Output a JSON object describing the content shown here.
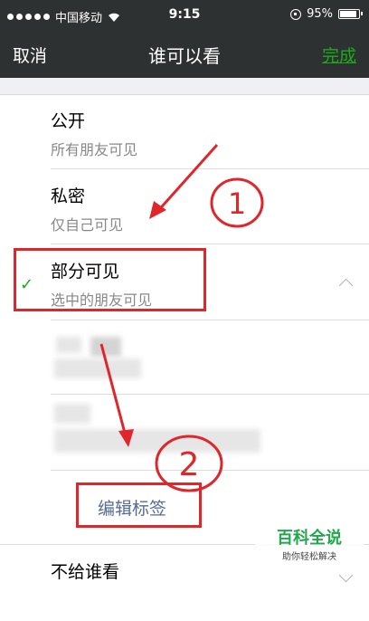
{
  "status_bar": {
    "carrier": "中国移动",
    "time": "9:15",
    "battery": "95%"
  },
  "nav": {
    "cancel": "取消",
    "title": "谁可以看",
    "done": "完成"
  },
  "options": [
    {
      "title": "公开",
      "subtitle": "所有朋友可见"
    },
    {
      "title": "私密",
      "subtitle": "仅自己可见"
    },
    {
      "title": "部分可见",
      "subtitle": "选中的朋友可见",
      "selected": true
    },
    {
      "title": "不给谁看",
      "subtitle": ""
    }
  ],
  "edit_tag": "编辑标签",
  "annotations": {
    "first": "1",
    "second": "2"
  },
  "watermark": {
    "main": "百科全说",
    "sub": "助你轻松解决"
  },
  "colors": {
    "accent_green": "#1aad19",
    "link_blue": "#576b95",
    "annotation_red": "#e0262b",
    "bar": "#2e3132"
  }
}
